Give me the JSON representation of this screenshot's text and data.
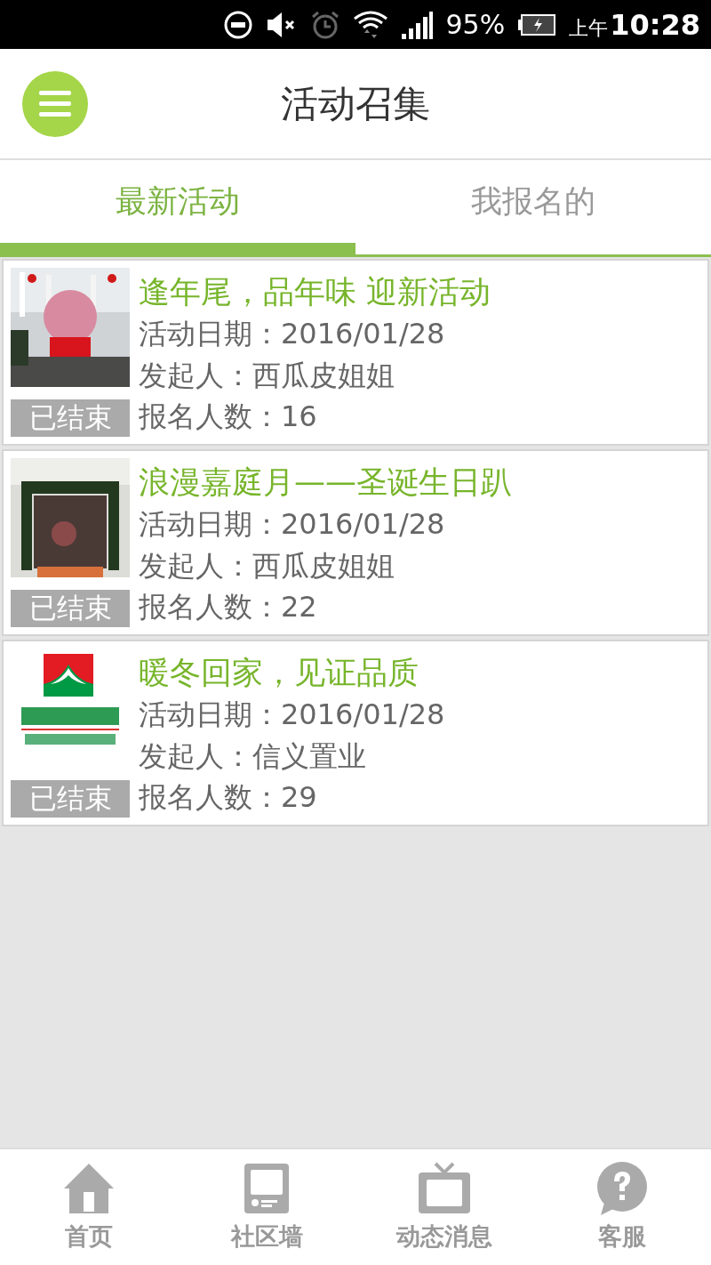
{
  "status_bar": {
    "battery": "95%",
    "period": "上午",
    "time": "10:28"
  },
  "header": {
    "title": "活动召集"
  },
  "tabs": [
    {
      "label": "最新活动",
      "selected": true
    },
    {
      "label": "我报名的",
      "selected": false
    }
  ],
  "activities": [
    {
      "badge": "已结束",
      "title": "逢年尾，品年味 迎新活动",
      "date": "活动日期：2016/01/28",
      "organizer": "发起人：西瓜皮姐姐",
      "signups": "报名人数：16"
    },
    {
      "badge": "已结束",
      "title": "浪漫嘉庭月——圣诞生日趴",
      "date": "活动日期：2016/01/28",
      "organizer": "发起人：西瓜皮姐姐",
      "signups": "报名人数：22"
    },
    {
      "badge": "已结束",
      "title": "暖冬回家，见证品质",
      "date": "活动日期：2016/01/28",
      "organizer": "发起人：信义置业",
      "signups": "报名人数：29"
    }
  ],
  "bottom_nav": [
    {
      "label": "首页"
    },
    {
      "label": "社区墙"
    },
    {
      "label": "动态消息"
    },
    {
      "label": "客服"
    }
  ]
}
